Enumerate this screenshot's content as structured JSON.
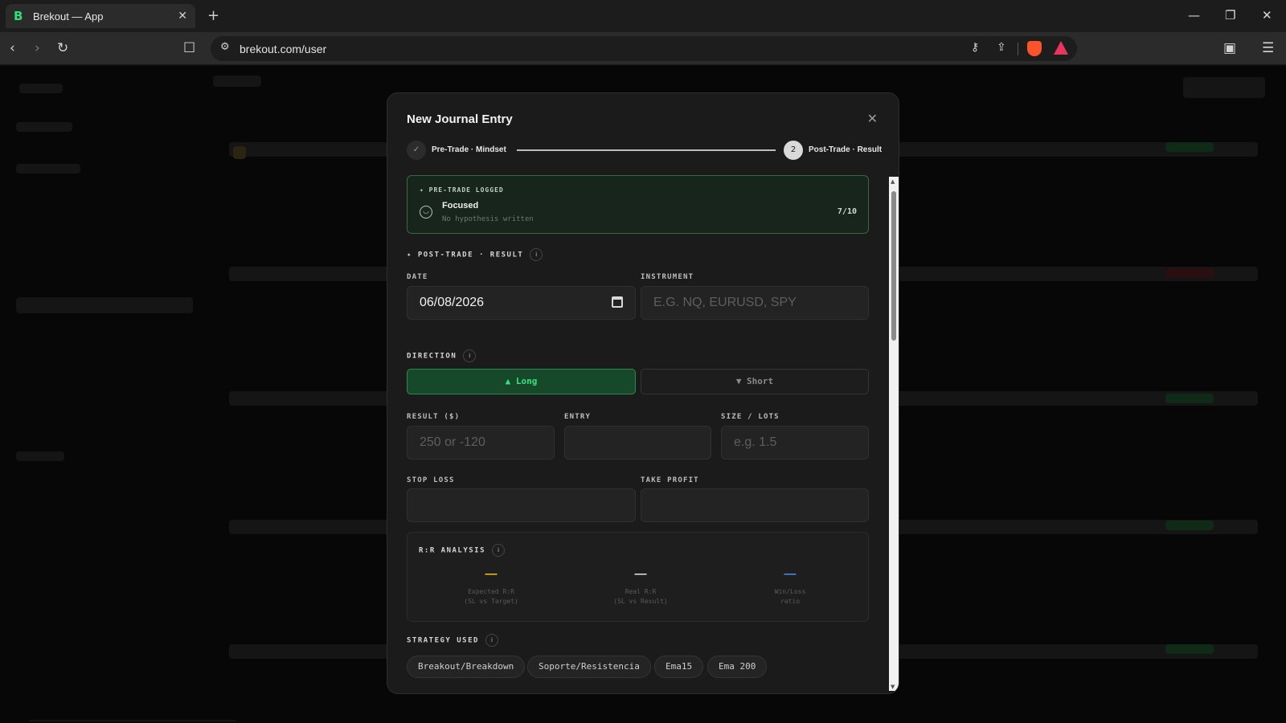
{
  "browser": {
    "tab_title": "Brekout — App",
    "tab_favicon": "B",
    "url": "brekout.com/user"
  },
  "modal": {
    "title": "New Journal Entry",
    "steps": [
      {
        "number": "✓",
        "label": "Pre-Trade · Mindset",
        "state": "done"
      },
      {
        "number": "2",
        "label": "Post-Trade · Result",
        "state": "active"
      }
    ],
    "pretrade": {
      "tag": "✦ PRE-TRADE LOGGED",
      "mood": "Focused",
      "hypothesis": "No hypothesis written",
      "score": "7/10"
    },
    "section_title": "✦ POST-TRADE · RESULT",
    "date": {
      "label": "DATE",
      "value": "06/08/2026"
    },
    "instrument": {
      "label": "INSTRUMENT",
      "placeholder": "E.G. NQ, EURUSD, SPY"
    },
    "direction": {
      "label": "DIRECTION",
      "long": "▲ Long",
      "short": "▼ Short",
      "selected": "long"
    },
    "result": {
      "label": "RESULT ($)",
      "placeholder": "250 or -120"
    },
    "entry": {
      "label": "ENTRY",
      "placeholder": ""
    },
    "size": {
      "label": "SIZE / LOTS",
      "placeholder": "e.g. 1.5"
    },
    "stop_loss": {
      "label": "STOP LOSS",
      "placeholder": ""
    },
    "take_profit": {
      "label": "TAKE PROFIT",
      "placeholder": ""
    },
    "rr": {
      "title": "R:R ANALYSIS",
      "items": [
        {
          "value": "—",
          "label_1": "Expected R:R",
          "label_2": "(SL vs Target)",
          "color": "#f5c518"
        },
        {
          "value": "—",
          "label_1": "Real R:R",
          "label_2": "(SL vs Result)",
          "color": "#e8e8e8"
        },
        {
          "value": "—",
          "label_1": "Win/Loss",
          "label_2": "ratio",
          "color": "#4f8df5"
        }
      ]
    },
    "strategy": {
      "title": "STRATEGY USED",
      "chips": [
        "Breakout/Breakdown",
        "Soporte/Resistencia",
        "Ema15",
        "Ema 200"
      ]
    }
  },
  "colors": {
    "accent_green": "#39e07d",
    "accent_yellow": "#f5c518",
    "accent_blue": "#4f8df5"
  }
}
